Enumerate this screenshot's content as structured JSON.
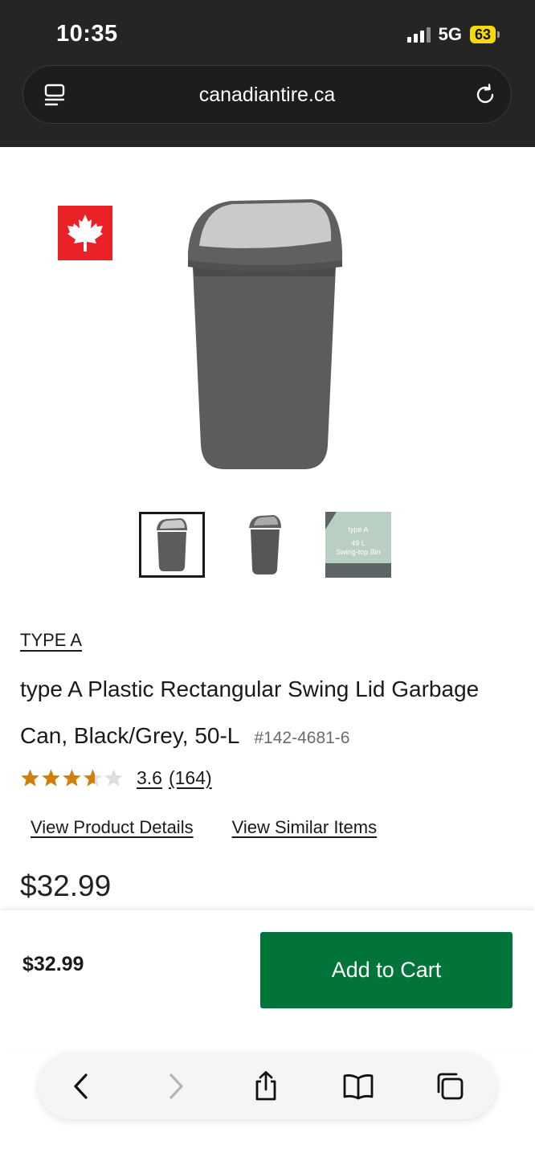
{
  "status_bar": {
    "time": "10:35",
    "network": "5G",
    "battery": "63"
  },
  "browser": {
    "url": "canadiantire.ca"
  },
  "product": {
    "brand": "TYPE A",
    "title_line1": "type A Plastic Rectangular Swing Lid Garbage",
    "title_line2": "Can, Black/Grey, 50-L",
    "sku": "#142-4681-6",
    "rating_value": "3.6",
    "review_count": "(164)",
    "rating_stars": 3.6,
    "rating_max": 5,
    "view_details_link": "View Product Details",
    "view_similar_link": "View Similar Items",
    "price": "$32.99",
    "thumbnail_pack_text": {
      "brand": "type A",
      "size": "49 L",
      "name": "Swing-top Bin"
    }
  },
  "sticky_bar": {
    "price": "$32.99",
    "add_to_cart_label": "Add to Cart"
  },
  "icons": {
    "reader": "reader-mode-icon",
    "reload": "reload-icon",
    "back": "back-chevron-icon",
    "forward": "forward-chevron-icon",
    "share": "share-icon",
    "bookmarks": "bookmarks-book-icon",
    "tabs": "tabs-icon",
    "flag": "maple-leaf-icon"
  },
  "colors": {
    "add_to_cart": "#037439",
    "star": "#d17f0b",
    "flag_red": "#ea2127",
    "chrome_bg": "#252525"
  }
}
